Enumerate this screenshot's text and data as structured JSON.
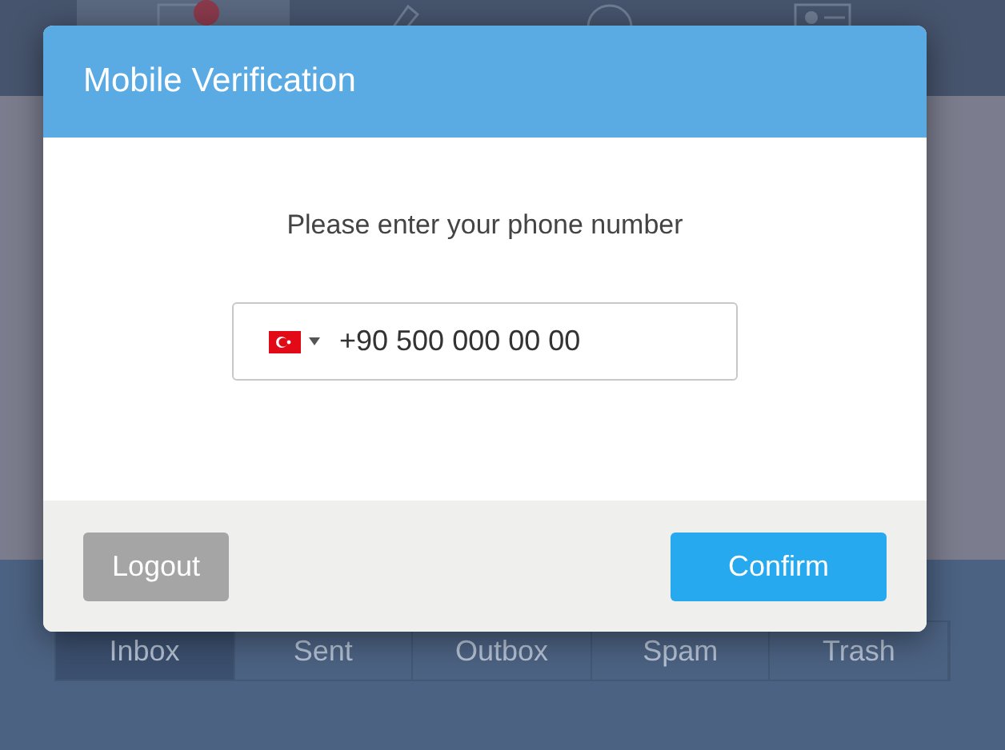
{
  "navigation": {
    "items": [
      {
        "selected": true,
        "badge": true
      },
      {
        "selected": false,
        "badge": false
      },
      {
        "selected": false,
        "badge": false
      },
      {
        "selected": false,
        "badge": false
      }
    ]
  },
  "folders": [
    {
      "label": "Inbox",
      "selected": true
    },
    {
      "label": "Sent",
      "selected": false
    },
    {
      "label": "Outbox",
      "selected": false
    },
    {
      "label": "Spam",
      "selected": false
    },
    {
      "label": "Trash",
      "selected": false
    }
  ],
  "dialog": {
    "title": "Mobile Verification",
    "prompt": "Please enter your phone number",
    "phone": {
      "value": "+90 500 000 00 00"
    },
    "buttons": [
      {
        "label": "Logout",
        "kind": "secondary"
      },
      {
        "label": "Confirm",
        "kind": "primary"
      }
    ]
  }
}
